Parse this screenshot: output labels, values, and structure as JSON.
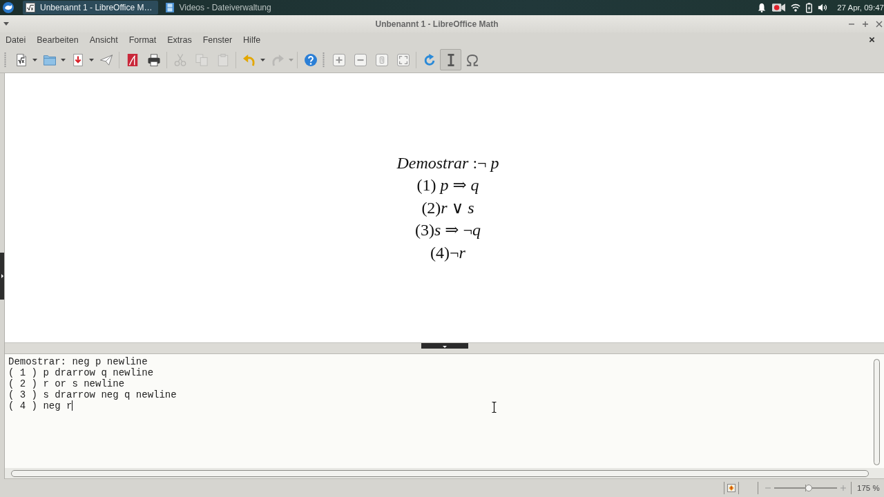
{
  "taskbar": {
    "tasks": [
      {
        "kind": "math",
        "label": "Unbenannt 1 - LibreOffice M…",
        "selected": true
      },
      {
        "kind": "files",
        "label": "Videos - Dateiverwaltung",
        "selected": false
      }
    ],
    "clock": "27 Apr, 09:47"
  },
  "window": {
    "title": "Unbenannt 1 - LibreOffice Math"
  },
  "menu": [
    "Datei",
    "Bearbeiten",
    "Ansicht",
    "Format",
    "Extras",
    "Fenster",
    "Hilfe"
  ],
  "toolbars": [
    {
      "groups": [
        {
          "buttons": [
            {
              "kind": "new",
              "dropdown": true,
              "disabled": false,
              "pressed": false
            },
            {
              "kind": "open",
              "dropdown": true,
              "disabled": false,
              "pressed": false
            },
            {
              "kind": "save",
              "dropdown": true,
              "disabled": false,
              "pressed": false
            },
            {
              "kind": "send",
              "dropdown": false,
              "disabled": false,
              "pressed": false
            }
          ]
        },
        {
          "buttons": [
            {
              "kind": "pdf",
              "dropdown": false,
              "disabled": false,
              "pressed": false
            },
            {
              "kind": "print",
              "dropdown": false,
              "disabled": false,
              "pressed": false
            }
          ]
        },
        {
          "buttons": [
            {
              "kind": "cut",
              "dropdown": false,
              "disabled": true,
              "pressed": false
            },
            {
              "kind": "copy",
              "dropdown": false,
              "disabled": true,
              "pressed": false
            },
            {
              "kind": "paste",
              "dropdown": false,
              "disabled": true,
              "pressed": false
            }
          ]
        },
        {
          "buttons": [
            {
              "kind": "undo",
              "dropdown": true,
              "disabled": false,
              "pressed": false
            },
            {
              "kind": "redo",
              "dropdown": true,
              "disabled": true,
              "pressed": false
            }
          ]
        },
        {
          "buttons": [
            {
              "kind": "help",
              "dropdown": false,
              "disabled": false,
              "pressed": false
            }
          ]
        }
      ]
    },
    {
      "groups": [
        {
          "buttons": [
            {
              "kind": "zoom_in",
              "dropdown": false,
              "disabled": false,
              "pressed": false
            },
            {
              "kind": "zoom_out",
              "dropdown": false,
              "disabled": false,
              "pressed": false
            },
            {
              "kind": "zoom_100",
              "dropdown": false,
              "disabled": false,
              "pressed": false
            },
            {
              "kind": "show_all",
              "dropdown": false,
              "disabled": false,
              "pressed": false
            }
          ]
        },
        {
          "buttons": [
            {
              "kind": "update",
              "dropdown": false,
              "disabled": false,
              "pressed": false
            },
            {
              "kind": "cursor",
              "dropdown": false,
              "disabled": false,
              "pressed": true
            },
            {
              "kind": "symbols",
              "dropdown": false,
              "disabled": false,
              "pressed": false
            }
          ]
        }
      ]
    }
  ],
  "formula": {
    "lines": [
      "*Demostrar* :¬ *p*",
      "(1) *p* ⇒ *q*",
      "(2)*r* ∨ *s*",
      "(3)*s* ⇒ ¬*q*",
      "(4)¬*r*"
    ]
  },
  "command_editor": {
    "lines": [
      "Demostrar: neg p newline",
      "( 1 ) p drarrow q newline",
      "( 2 ) r or s newline",
      "( 3 ) s drarrow neg q newline",
      "( 4 ) neg r"
    ]
  },
  "status_bar": {
    "zoom": {
      "level": 0.55,
      "reading": "175 %"
    }
  }
}
